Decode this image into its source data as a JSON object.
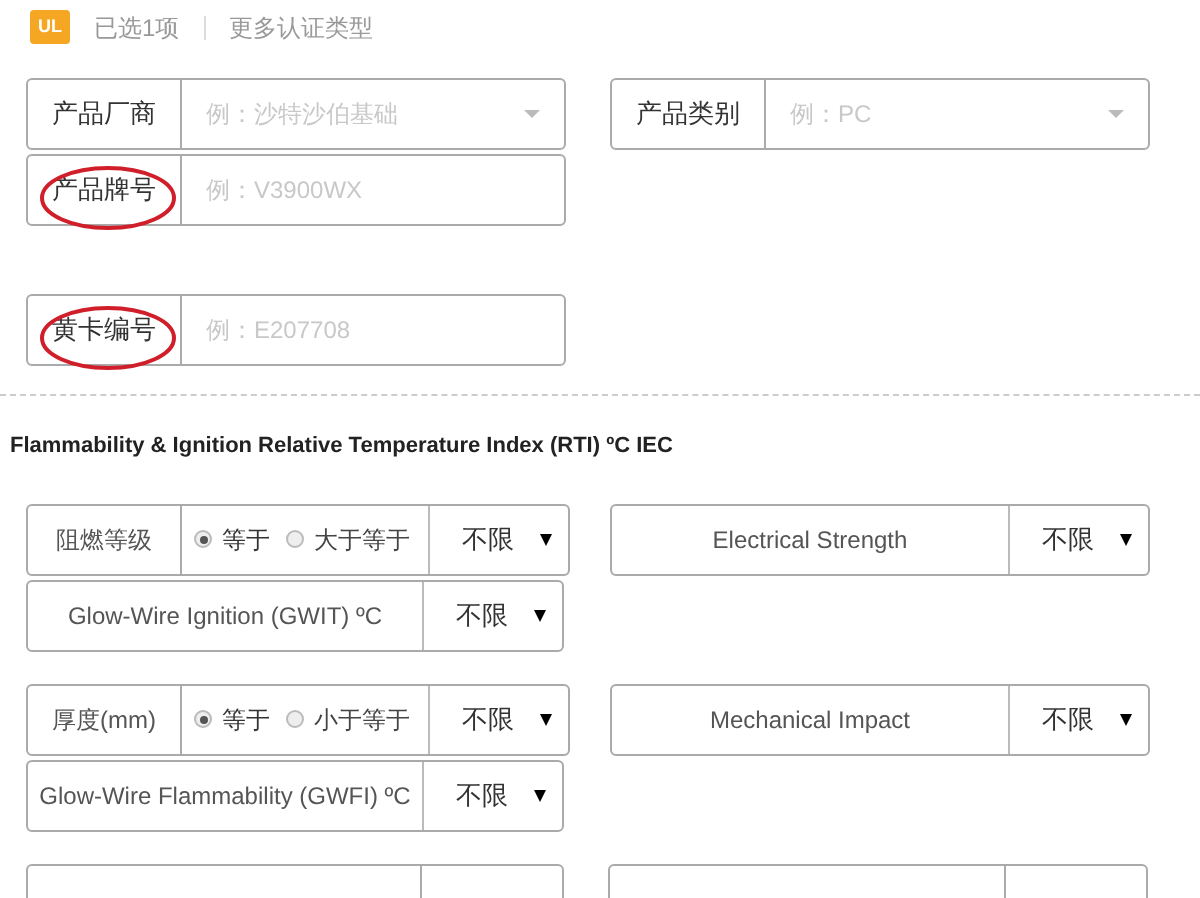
{
  "cert_bar": {
    "tag": "UL",
    "selected_count": "已选1项",
    "more_link": "更多认证类型"
  },
  "product_fields": [
    {
      "label": "产品厂商",
      "placeholder": "例：沙特沙伯基础",
      "kind": "dropdown",
      "circled": false
    },
    {
      "label": "产品类别",
      "placeholder": "例：PC",
      "kind": "dropdown",
      "circled": false
    },
    {
      "label": "产品牌号",
      "placeholder": "例：V3900WX",
      "kind": "text",
      "circled": true
    },
    {
      "label": "黄卡编号",
      "placeholder": "例：E207708",
      "kind": "text",
      "circled": true
    }
  ],
  "section_title": "Flammability & Ignition Relative Temperature Index (RTI) ºC IEC",
  "filter_groups": [
    {
      "left": {
        "label": "阻燃等级",
        "options": [
          {
            "label": "等于",
            "selected": true
          },
          {
            "label": "大于等于",
            "selected": false
          }
        ],
        "value": "不限"
      },
      "right": {
        "label": "Electrical Strength",
        "value": "不限"
      },
      "below": {
        "label": "Glow-Wire Ignition (GWIT) ºC",
        "value": "不限"
      }
    },
    {
      "left": {
        "label": "厚度(mm)",
        "options": [
          {
            "label": "等于",
            "selected": true
          },
          {
            "label": "小于等于",
            "selected": false
          }
        ],
        "value": "不限"
      },
      "right": {
        "label": "Mechanical Impact",
        "value": "不限"
      },
      "below": {
        "label": "Glow-Wire Flammability (GWFI) ºC",
        "value": "不限"
      }
    }
  ]
}
